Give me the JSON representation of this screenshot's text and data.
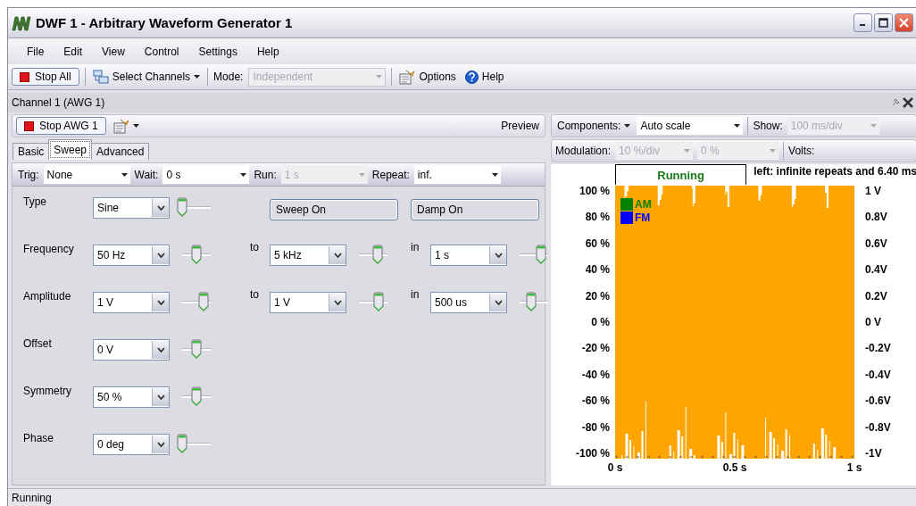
{
  "window": {
    "title": "DWF 1 - Arbitrary Waveform Generator 1"
  },
  "menu": [
    "File",
    "Edit",
    "View",
    "Control",
    "Settings",
    "Help"
  ],
  "toolbar": {
    "stop_all": "Stop All",
    "select_channels": "Select Channels",
    "mode_label": "Mode:",
    "mode": {
      "value": "Independent",
      "disabled": true
    },
    "options": "Options",
    "help": "Help"
  },
  "channel_panel": {
    "title": "Channel 1 (AWG 1)"
  },
  "channel_toolbar": {
    "stop": "Stop AWG 1",
    "preview": "Preview"
  },
  "tabs": [
    {
      "label": "Basic",
      "selected": false
    },
    {
      "label": "Sweep",
      "selected": true
    },
    {
      "label": "Advanced",
      "selected": false
    }
  ],
  "sweep_bar": [
    {
      "label": "Trig:",
      "value": "None",
      "disabled": false
    },
    {
      "label": "Wait:",
      "value": "0 s",
      "disabled": false
    },
    {
      "label": "Run:",
      "value": "1 s",
      "disabled": true
    },
    {
      "label": "Repeat:",
      "value": "inf.",
      "disabled": false
    }
  ],
  "parameters": [
    {
      "label": "Type",
      "controls": [
        {
          "kind": "combo",
          "value": "Sine"
        },
        {
          "kind": "toggle",
          "label": "Sweep On"
        },
        {
          "kind": "toggle",
          "label": "Damp On"
        }
      ]
    },
    {
      "label": "Frequency",
      "controls": [
        {
          "kind": "combo",
          "value": "50 Hz"
        },
        {
          "kind": "combo",
          "prefix": "to",
          "value": "5 kHz",
          "level": 0.65
        },
        {
          "kind": "combo",
          "prefix": "in",
          "value": "1 s"
        }
      ]
    },
    {
      "label": "Amplitude",
      "controls": [
        {
          "kind": "combo",
          "value": "1 V"
        },
        {
          "kind": "combo",
          "prefix": "to",
          "value": "1 V",
          "level": 0.7
        },
        {
          "kind": "combo",
          "prefix": "in",
          "value": "500 us"
        }
      ]
    },
    {
      "label": "Offset",
      "controls": [
        {
          "kind": "combo",
          "value": "0 V"
        }
      ]
    },
    {
      "label": "Symmetry",
      "controls": [
        {
          "kind": "combo",
          "value": "50 %"
        }
      ]
    },
    {
      "label": "Phase",
      "controls": [
        {
          "kind": "combo",
          "value": "0 deg"
        }
      ]
    }
  ],
  "plot": {
    "components": "Components:",
    "scale": "Auto scale",
    "show_label": "Show:",
    "show": {
      "value": "100 ms/div",
      "disabled": true
    },
    "modulation_label": "Modulation:",
    "modulation": [
      {
        "value": "10 %/div",
        "disabled": true
      },
      {
        "value": "0 %",
        "disabled": true
      }
    ],
    "volts_label": "Volts:",
    "state": "Running",
    "info": "left: infinite repeats and 6.40 ms",
    "legend": [
      {
        "label": "AM",
        "color": "#008000"
      },
      {
        "label": "FM",
        "color": "#0000ff"
      }
    ],
    "left_ticks": [
      "100 %",
      "80 %",
      "60 %",
      "40 %",
      "20 %",
      "0 %",
      "-20 %",
      "-40 %",
      "-60 %",
      "-80 %",
      "-100 %"
    ],
    "right_ticks": [
      "1 V",
      "0.8V",
      "0.6V",
      "0.4V",
      "0.2V",
      "0 V",
      "-0.2V",
      "-0.4V",
      "-0.6V",
      "-0.8V",
      "-1V"
    ],
    "x_ticks": [
      "0 s",
      "0.5 s",
      "1 s"
    ]
  },
  "status_bar": "Running"
}
